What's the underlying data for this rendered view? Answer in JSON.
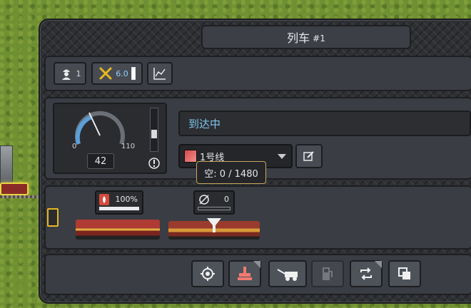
{
  "window": {
    "title": "列车",
    "number": "#1"
  },
  "toolbar": {
    "passengers": "1",
    "condition": "6.0"
  },
  "speedometer": {
    "min": "0",
    "max": "110",
    "speed": "42"
  },
  "status": {
    "text": "到达中"
  },
  "line": {
    "name": "1号线"
  },
  "tooltip": {
    "text": "空: 0 / 1480"
  },
  "vehicles": {
    "locomotive": {
      "fuel": "100%"
    },
    "wagon": {
      "load": "0"
    }
  },
  "icons": [
    "worker-icon",
    "wrench-icon",
    "chart-icon",
    "warning-icon",
    "edit-icon",
    "fire-icon",
    "empty-icon",
    "target-icon",
    "paint-icon",
    "tow-truck-icon",
    "fuel-pump-icon",
    "reverse-icon",
    "copy-icon"
  ],
  "colors": {
    "status_text": "#7fc4ee",
    "line_color": "#d84848",
    "gauge_arc": "#5a9fd8"
  }
}
